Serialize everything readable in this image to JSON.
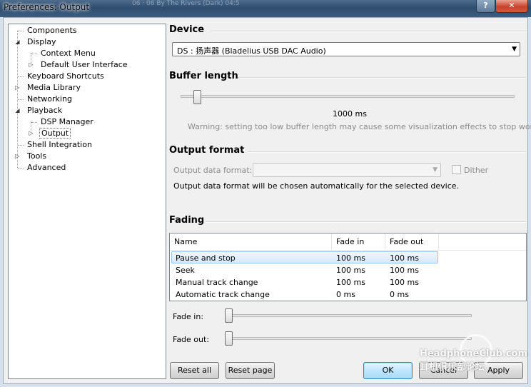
{
  "window": {
    "title": "Preferences: Output",
    "background_text": "06 · 06 By The Rivers (Dark)          04:5",
    "help_glyph": "?",
    "close_glyph": "✕"
  },
  "tree": {
    "items": [
      {
        "label": "Components"
      },
      {
        "label": "Display",
        "expander": "◢"
      },
      {
        "label": "Context Menu"
      },
      {
        "label": "Default User Interface",
        "expander": "▷"
      },
      {
        "label": "Keyboard Shortcuts"
      },
      {
        "label": "Media Library",
        "expander": "▷"
      },
      {
        "label": "Networking"
      },
      {
        "label": "Playback",
        "expander": "◢"
      },
      {
        "label": "DSP Manager"
      },
      {
        "label": "Output",
        "expander": "▷",
        "selected": true
      },
      {
        "label": "Shell Integration"
      },
      {
        "label": "Tools",
        "expander": "▷"
      },
      {
        "label": "Advanced"
      }
    ]
  },
  "device": {
    "title": "Device",
    "selected": "DS : 扬声器 (Bladelius USB DAC Audio)",
    "arrow": "▼"
  },
  "buffer": {
    "title": "Buffer length",
    "value_label": "1000 ms",
    "slider_value": 0.04,
    "warning": "Warning: setting too low buffer length may cause some visualization effects to stop working."
  },
  "output_format": {
    "title": "Output format",
    "label": "Output data format:",
    "selected": "",
    "arrow": "▼",
    "dither_label": "Dither",
    "dither_checked": false,
    "info": "Output data format will be chosen automatically for the selected device."
  },
  "fading": {
    "title": "Fading",
    "columns": [
      "Name",
      "Fade in",
      "Fade out"
    ],
    "rows": [
      {
        "name": "Pause and stop",
        "fade_in": "100 ms",
        "fade_out": "100 ms",
        "selected": true
      },
      {
        "name": "Seek",
        "fade_in": "100 ms",
        "fade_out": "100 ms"
      },
      {
        "name": "Manual track change",
        "fade_in": "100 ms",
        "fade_out": "100 ms"
      },
      {
        "name": "Automatic track change",
        "fade_in": "0 ms",
        "fade_out": "0 ms"
      }
    ],
    "fade_in_label": "Fade in:",
    "fade_in_value": 0.0,
    "fade_out_label": "Fade out:",
    "fade_out_value": 0.0
  },
  "buttons": {
    "reset_all": "Reset all",
    "reset_page": "Reset page",
    "ok": "OK",
    "cancel": "Cancel",
    "apply": "Apply"
  },
  "watermark": "HeadphoneClub.com 耳机俱乐部论坛"
}
